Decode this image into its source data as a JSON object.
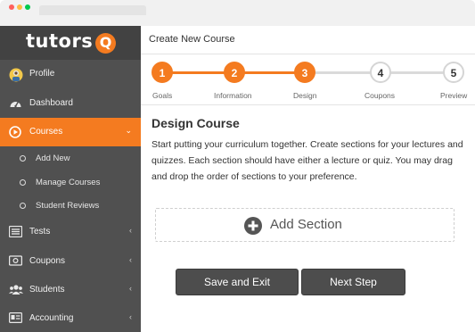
{
  "brand": {
    "name": "tutors",
    "mark": "Q",
    "accent": "#f47b20"
  },
  "sidebar": {
    "items": [
      {
        "label": "Profile",
        "icon": "avatar-icon"
      },
      {
        "label": "Dashboard",
        "icon": "dashboard-icon"
      },
      {
        "label": "Courses",
        "icon": "play-circle-icon",
        "active": true,
        "chevron": "⌄"
      },
      {
        "label": "Tests",
        "icon": "list-icon",
        "chevron": "‹"
      },
      {
        "label": "Coupons",
        "icon": "money-icon",
        "chevron": "‹"
      },
      {
        "label": "Students",
        "icon": "users-icon",
        "chevron": "‹"
      },
      {
        "label": "Accounting",
        "icon": "id-card-icon",
        "chevron": "‹"
      }
    ],
    "subitems": [
      {
        "label": "Add New"
      },
      {
        "label": "Manage Courses"
      },
      {
        "label": "Student Reviews"
      }
    ]
  },
  "header": {
    "title": "Create New Course"
  },
  "steps": [
    {
      "number": "1",
      "label": "Goals",
      "state": "done"
    },
    {
      "number": "2",
      "label": "Information",
      "state": "done"
    },
    {
      "number": "3",
      "label": "Design",
      "state": "done"
    },
    {
      "number": "4",
      "label": "Coupons",
      "state": "todo"
    },
    {
      "number": "5",
      "label": "Preview",
      "state": "todo"
    }
  ],
  "content": {
    "title": "Design Course",
    "description": "Start putting your curriculum together. Create sections for your lectures and quizzes. Each section should have either a lecture or quiz. You may drag and drop the order of sections to your preference.",
    "add_section_label": "Add Section"
  },
  "buttons": {
    "save_label": "Save and Exit",
    "next_label": "Next Step"
  }
}
